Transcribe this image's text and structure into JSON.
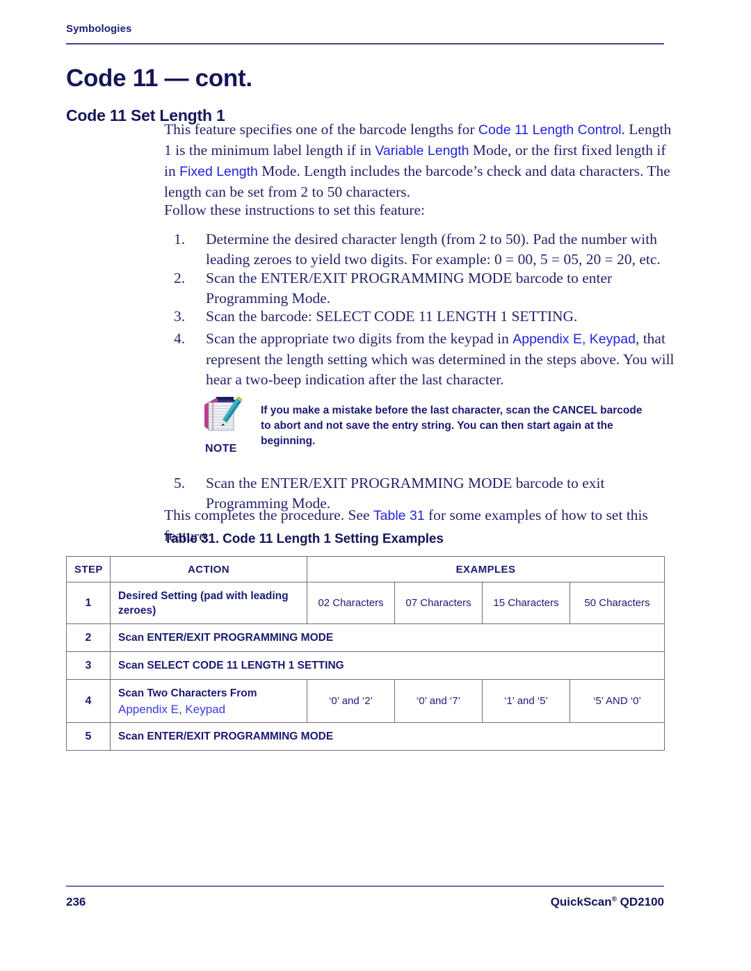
{
  "header": {
    "running_title": "Symbologies",
    "chapter_title": "Code 11 — cont.",
    "section_title": "Code 11 Set Length 1"
  },
  "intro": {
    "p1_part1": "This feature specifies one of the barcode lengths for ",
    "p1_link1": "Code 11 Length Control",
    "p1_part2": ". Length 1 is the minimum label length if in ",
    "p1_link2": "Variable Length",
    "p1_part3": " Mode, or the first fixed length if in ",
    "p1_link3": "Fixed Length",
    "p1_part4": " Mode. Length includes the barcode’s check and data characters. The length can be set from 2 to 50 characters.",
    "p2": "Follow these instructions to set this feature:"
  },
  "steps": [
    {
      "marker": "1.",
      "text": "Determine the desired character length (from 2 to 50). Pad the number with leading zeroes to yield two digits. For example: 0 = 00, 5 = 05, 20 = 20, etc."
    },
    {
      "marker": "2.",
      "text": "Scan the ENTER/EXIT PROGRAMMING MODE barcode to enter Programming Mode."
    },
    {
      "marker": "3.",
      "text": "Scan the barcode: SELECT CODE 11 LENGTH 1 SETTING."
    },
    {
      "marker": "4.",
      "part1": "Scan the appropriate two digits from the keypad in ",
      "link": "Appendix E, Keypad",
      "part2": ", that represent the length setting which was determined in the steps above. You will hear a two-beep indication after the last character."
    },
    {
      "marker": "5.",
      "text": "Scan the ENTER/EXIT PROGRAMMING MODE barcode to exit Programming Mode."
    }
  ],
  "note": {
    "label": "NOTE",
    "text": "If you make a mistake before the last character, scan the CANCEL barcode to abort and not save the entry string. You can then start again at the beginning."
  },
  "closing": {
    "part1": "This completes the procedure. See ",
    "link": "Table 31",
    "part2": " for some examples of how to set this feature."
  },
  "table": {
    "caption": "Table 31. Code 11 Length 1 Setting Examples",
    "headers": {
      "step": "STEP",
      "action": "ACTION",
      "examples": "EXAMPLES"
    },
    "rows": [
      {
        "step": "1",
        "action": "Desired Setting (pad with leading zeroes)",
        "action_link": "",
        "examples": [
          "02 Characters",
          "07 Characters",
          "15 Characters",
          "50 Characters"
        ]
      },
      {
        "step": "2",
        "action": "Scan ENTER/EXIT PROGRAMMING MODE",
        "action_link": "",
        "examples": []
      },
      {
        "step": "3",
        "action": "Scan SELECT CODE 11 LENGTH 1 SETTING",
        "action_link": "",
        "examples": []
      },
      {
        "step": "4",
        "action": "Scan Two Characters From",
        "action_link": "Appendix E, Keypad",
        "examples": [
          "‘0’ and ‘2’",
          "‘0’ and ‘7’",
          "‘1’ and ‘5’",
          "‘5’ AND ‘0’"
        ]
      },
      {
        "step": "5",
        "action": "Scan ENTER/EXIT PROGRAMMING MODE",
        "action_link": "",
        "examples": []
      }
    ]
  },
  "footer": {
    "page_number": "236",
    "product_name": "QuickScan",
    "product_mark": "®",
    "product_model": " QD2100"
  },
  "colors": {
    "navy_heading": "#151559",
    "navy_body": "#232369",
    "link_blue": "#2222dd",
    "rule": "#413f8e",
    "table_border": "#6b6b84"
  }
}
